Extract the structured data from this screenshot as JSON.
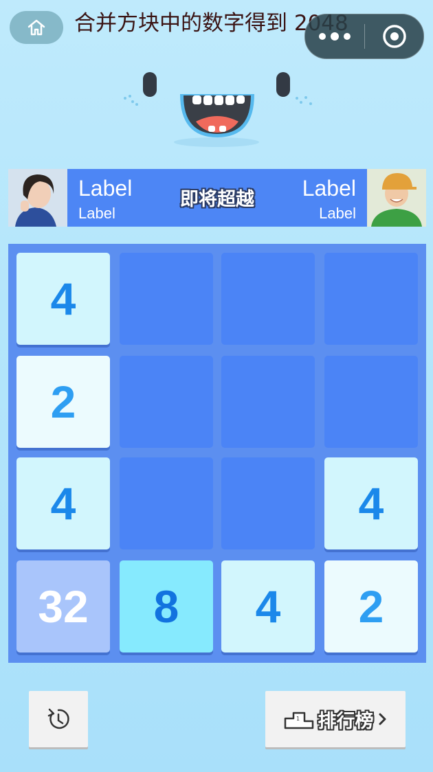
{
  "header": {
    "title": "合并方块中的数字得到 2048",
    "home_icon": "home-icon",
    "more_icon": "more-dots-icon",
    "close_icon": "target-close-icon"
  },
  "rival": {
    "left_name": "Label",
    "left_score": "Label",
    "right_name": "Label",
    "right_score": "Label",
    "status": "即将超越"
  },
  "board": {
    "size": 4,
    "tiles": [
      {
        "row": 0,
        "col": 0,
        "value": "4"
      },
      {
        "row": 1,
        "col": 0,
        "value": "2"
      },
      {
        "row": 2,
        "col": 0,
        "value": "4"
      },
      {
        "row": 2,
        "col": 3,
        "value": "4"
      },
      {
        "row": 3,
        "col": 0,
        "value": "32"
      },
      {
        "row": 3,
        "col": 1,
        "value": "8"
      },
      {
        "row": 3,
        "col": 2,
        "value": "4"
      },
      {
        "row": 3,
        "col": 3,
        "value": "2"
      }
    ]
  },
  "footer": {
    "undo_icon": "undo-icon",
    "rank_label": "排行榜",
    "rank_icon": "podium-icon",
    "chevron_icon": "chevron-right-icon"
  },
  "colors": {
    "background": "#b4e6fb",
    "board": "#5c8ff0",
    "empty_cell": "#4b84f6",
    "rival_bar": "#4d86f5"
  }
}
